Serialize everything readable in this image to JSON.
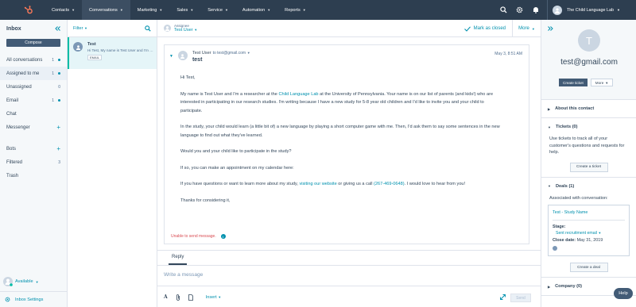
{
  "topnav": {
    "items": [
      {
        "label": "Contacts"
      },
      {
        "label": "Conversations"
      },
      {
        "label": "Marketing"
      },
      {
        "label": "Sales"
      },
      {
        "label": "Service"
      },
      {
        "label": "Automation"
      },
      {
        "label": "Reports"
      }
    ],
    "active_index": 1,
    "portal_name": "The Child Language Lab"
  },
  "sidebar": {
    "title": "Inbox",
    "compose_label": "Compose",
    "items": [
      {
        "label": "All conversations",
        "count": "1"
      },
      {
        "label": "Assigned to me",
        "count": "1"
      },
      {
        "label": "Unassigned",
        "count": "0"
      },
      {
        "label": "Email",
        "count": "1"
      },
      {
        "label": "Chat",
        "count": ""
      },
      {
        "label": "Messenger",
        "count": ""
      }
    ],
    "items2": [
      {
        "label": "Bots",
        "count": ""
      },
      {
        "label": "Filtered",
        "count": "3"
      },
      {
        "label": "Trash",
        "count": ""
      }
    ],
    "availability": "Available",
    "settings_label": "Inbox Settings"
  },
  "threads": {
    "filter_label": "Filter",
    "items": [
      {
        "name": "Test",
        "preview": "Hi Test, My name is Test User and I'm a researcher at the Child Language Lab",
        "badge": "EMAIL"
      }
    ]
  },
  "conversation": {
    "assignee_label": "Assignee",
    "assignee_name": "Test User",
    "mark_closed_label": "Mark as closed",
    "more_label": "More",
    "message": {
      "from": "Test User",
      "to": "to test@gmail.com",
      "date": "May 3, 8:51 AM",
      "subject": "test",
      "greeting": "Hi Test,",
      "p1_a": "My name is Test User and I'm a researcher at the ",
      "p1_link": "Child Language Lab",
      "p1_b": " at the University of Pennsylvania. Your name is on our list of parents (and kids!) who are interested in participating in our research studies. I'm writing because I have a new study for 5-8 year old children and I'd like to invite you and your child to participate.",
      "p2": "In the study, your child would learn (a little bit of) a new language by playing a short computer game with me. Then, I'd ask them to say some sentences in the new language to find out what they've learned.",
      "p3": "Would you and your child like to participate in the study?",
      "p4": "If so, you can make an appointment on my calendar here:",
      "p5_a": "If you have questions or want to learn more about my study, ",
      "p5_link1": "visiting our website",
      "p5_b": " or giving us a call ",
      "p5_link2": "(267-469-0648)",
      "p5_c": ". I would love to hear from you!",
      "signoff": "Thanks for considering it,",
      "error": "Unable to send message."
    },
    "composer": {
      "tab_label": "Reply",
      "placeholder": "Write a message",
      "insert_label": "Insert",
      "send_label": "Send"
    }
  },
  "contact_panel": {
    "avatar_letter": "T",
    "email": "test@gmail.com",
    "create_ticket_label": "Create ticket",
    "more_label": "More",
    "about_label": "About this contact",
    "tickets_label": "Tickets (0)",
    "tickets_text": "Use tickets to track all of your customer's questions and requests for help.",
    "tickets_button": "Create a ticket",
    "deals_label": "Deals (1)",
    "deals_assoc": "Associated with conversation:",
    "deal_name": "Test - Study Name",
    "stage_label": "Stage:",
    "stage_value": "Sent recruitment email",
    "close_label": "Close date:",
    "close_value": "May 31, 2019",
    "deals_button": "Create a deal",
    "company_label": "Company (0)",
    "help_label": "Help"
  }
}
